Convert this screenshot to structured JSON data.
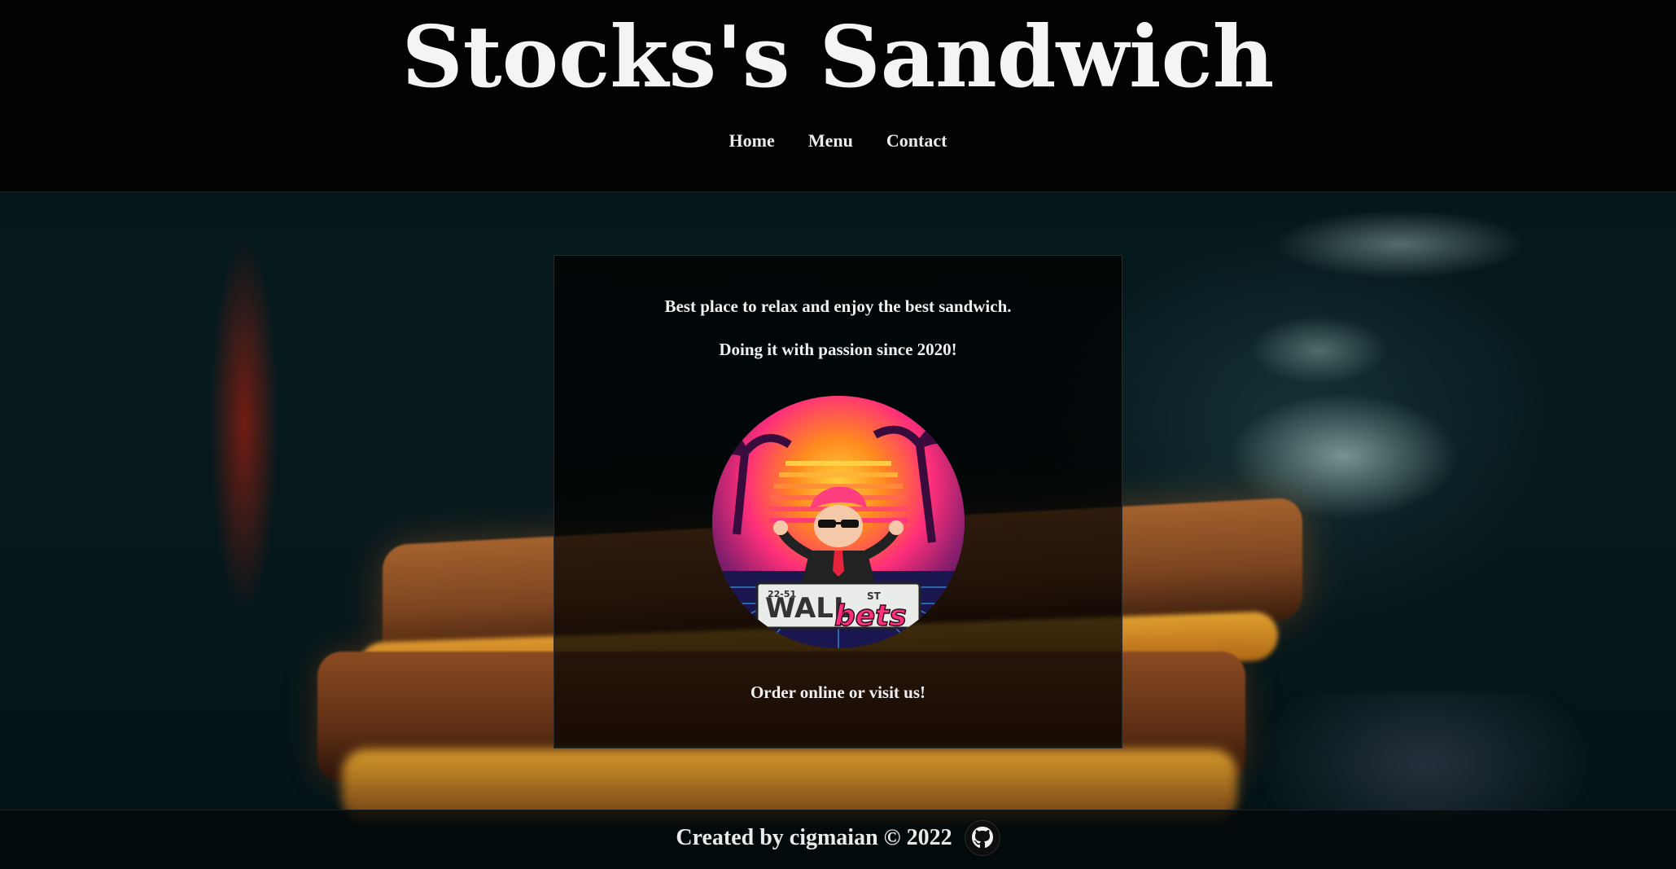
{
  "header": {
    "title": "Stocks's Sandwich",
    "nav": [
      "Home",
      "Menu",
      "Contact"
    ]
  },
  "card": {
    "line1": "Best place to relax and enjoy the best sandwich.",
    "line2": "Doing it with passion since 2020!",
    "logo_icon": "wallstreetbets-logo",
    "logo_text_main": "WALL",
    "logo_text_accent": "bets",
    "logo_text_sign": "ST",
    "logo_text_number": "22-51",
    "line3": "Order online or visit us!"
  },
  "footer": {
    "credit": "Created by cigmaian © 2022",
    "icon": "github-icon"
  },
  "colors": {
    "header_bg": "#010303",
    "text": "#f2f2f2",
    "logo_pink": "#ff2f7a",
    "logo_orange": "#ff8a1e"
  }
}
